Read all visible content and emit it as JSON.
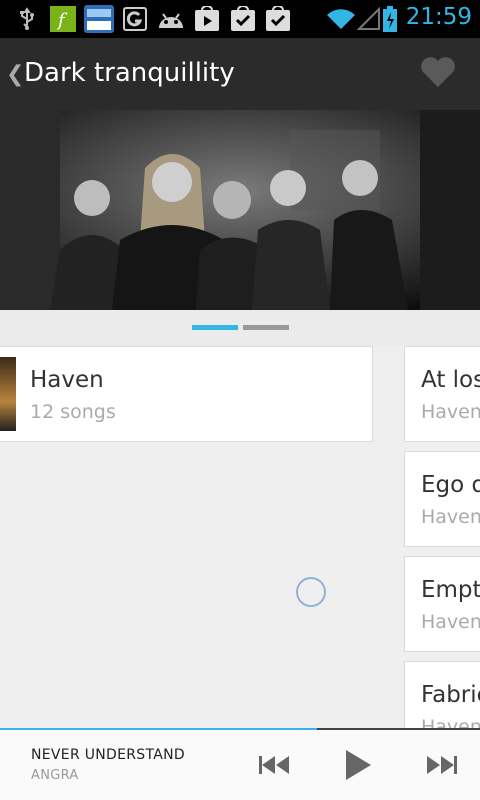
{
  "status_bar": {
    "time": "21:59",
    "icons": [
      "usb-icon",
      "app-icon-green",
      "app-icon-deal",
      "g-icon",
      "android-icon",
      "play-store-icon",
      "check-bag-icon",
      "check-bag-icon",
      "wifi-icon",
      "signal-icon",
      "battery-charging-icon"
    ]
  },
  "action_bar": {
    "title": "Dark tranquillity",
    "back_icon": "chevron-left-icon",
    "favorite_icon": "heart-icon"
  },
  "pager": {
    "pages": 2,
    "active_index": 0,
    "active_color": "#33b5e5",
    "inactive_color": "#999999"
  },
  "album": {
    "title": "Haven",
    "subtitle": "12 songs"
  },
  "songs": [
    {
      "title": "At los",
      "subtitle": "Haven"
    },
    {
      "title": "Ego d",
      "subtitle": "Haven"
    },
    {
      "title": "Empti",
      "subtitle": "Haven"
    },
    {
      "title": "Fabric",
      "subtitle": "Haven"
    }
  ],
  "player": {
    "track": "NEVER UNDERSTAND",
    "artist": "ANGRA",
    "progress": 0.66,
    "accent": "#33b5e5"
  }
}
